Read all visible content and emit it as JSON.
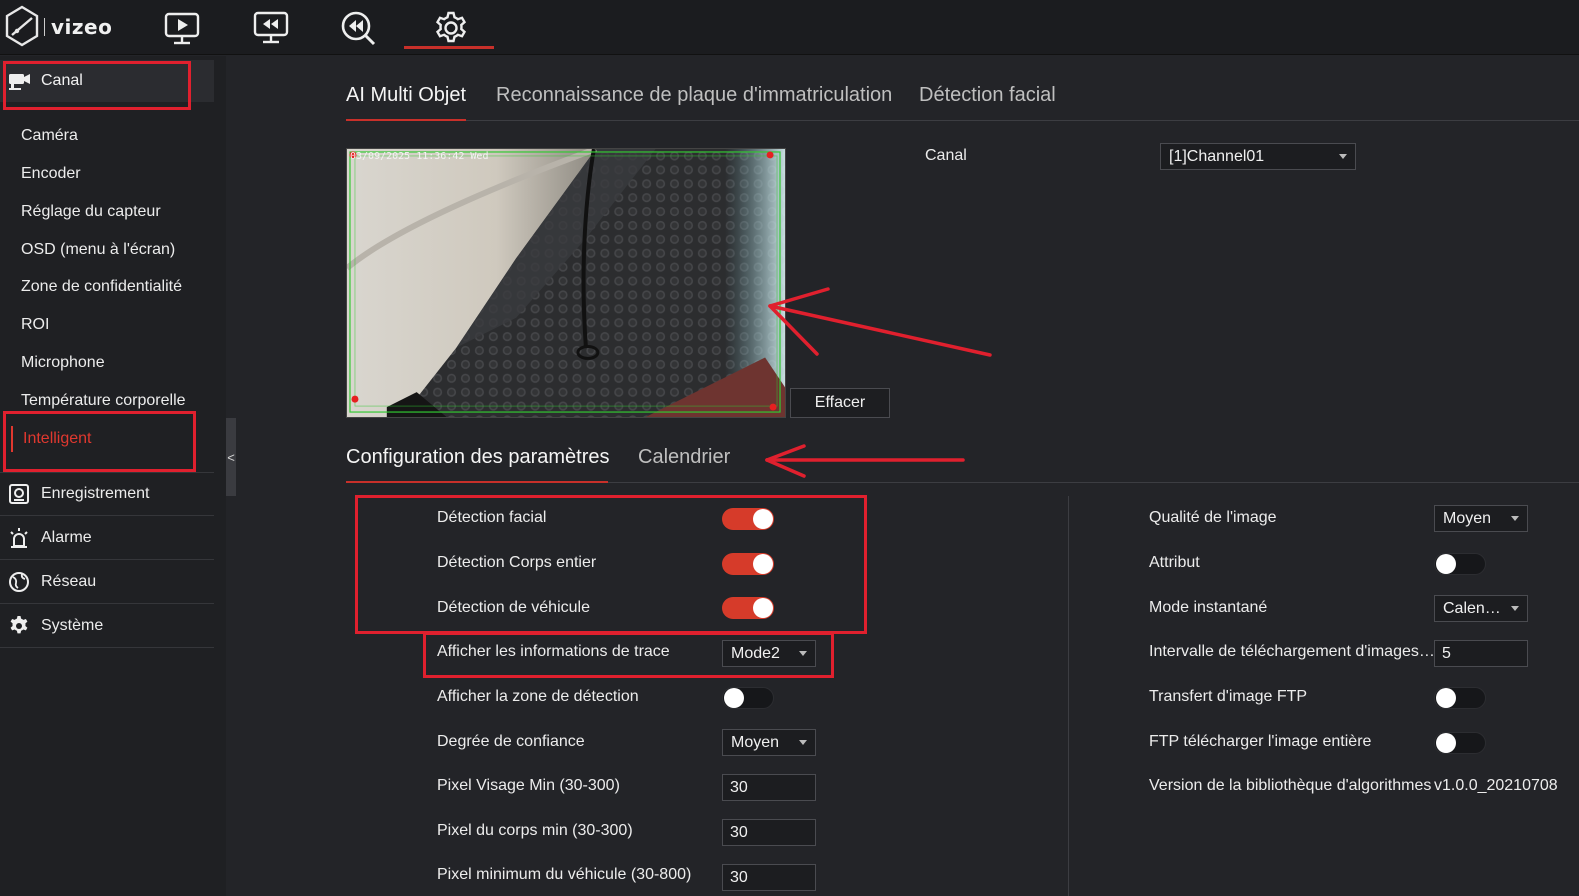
{
  "brand": {
    "name": "vizeo"
  },
  "nav": {
    "icons": [
      "live-view-icon",
      "playback-icon",
      "search-playback-icon",
      "settings-icon"
    ],
    "active": "settings-icon"
  },
  "sidebar": {
    "header": {
      "label": "Canal",
      "icon": "camera-icon"
    },
    "sub_items": [
      "Caméra",
      "Encoder",
      "Réglage du capteur",
      "OSD (menu à l'écran)",
      "Zone de confidentialité",
      "ROI",
      "Microphone",
      "Température corporelle",
      "Intelligent"
    ],
    "active_sub": "Intelligent",
    "groups": [
      {
        "label": "Enregistrement",
        "icon": "record-icon"
      },
      {
        "label": "Alarme",
        "icon": "alarm-icon"
      },
      {
        "label": "Réseau",
        "icon": "globe-icon"
      },
      {
        "label": "Système",
        "icon": "gear-icon"
      }
    ],
    "collapse_glyph": "<"
  },
  "tabs_top": [
    "AI Multi Objet",
    "Reconnaissance de plaque d'immatriculation",
    "Détection facial"
  ],
  "active_tab_top": "AI Multi Objet",
  "preview": {
    "timestamp": "03/09/2025 11:36:42 Wed",
    "clear_button": "Effacer"
  },
  "channel": {
    "label": "Canal",
    "value": "[1]Channel01"
  },
  "tabs_sub": [
    "Configuration des paramètres",
    "Calendrier"
  ],
  "active_tab_sub": "Configuration des paramètres",
  "left_settings": {
    "face_detection": {
      "label": "Détection facial",
      "on": true
    },
    "body_detection": {
      "label": "Détection Corps entier",
      "on": true
    },
    "vehicle_detection": {
      "label": "Détection de véhicule",
      "on": true
    },
    "trace_info": {
      "label": "Afficher les informations de trace",
      "value": "Mode2"
    },
    "detection_zone": {
      "label": "Afficher la zone de détection",
      "on": false
    },
    "confidence": {
      "label": "Degrée de confiance",
      "value": "Moyen"
    },
    "min_face_px": {
      "label": "Pixel Visage Min (30-300)",
      "value": "30"
    },
    "min_body_px": {
      "label": "Pixel du corps min (30-300)",
      "value": "30"
    },
    "min_vehicle_px": {
      "label": "Pixel minimum du véhicule (30-800)",
      "value": "30"
    }
  },
  "right_settings": {
    "image_quality": {
      "label": "Qualité de l'image",
      "value": "Moyen"
    },
    "attribute": {
      "label": "Attribut",
      "on": false
    },
    "snapshot_mode": {
      "label": "Mode instantané",
      "value": "Calen…"
    },
    "upload_interval": {
      "label": "Intervalle de téléchargement d'images…",
      "value": "5"
    },
    "ftp_transfer": {
      "label": "Transfert d'image FTP",
      "on": false
    },
    "ftp_full_image": {
      "label": "FTP télécharger l'image entière",
      "on": false
    },
    "algo_version": {
      "label": "Version de la bibliothèque d'algorithmes",
      "value": "v1.0.0_20210708"
    }
  },
  "colors": {
    "accent": "#c8302a",
    "annotation": "#e0202e",
    "toggle_on": "#d63b2a"
  }
}
